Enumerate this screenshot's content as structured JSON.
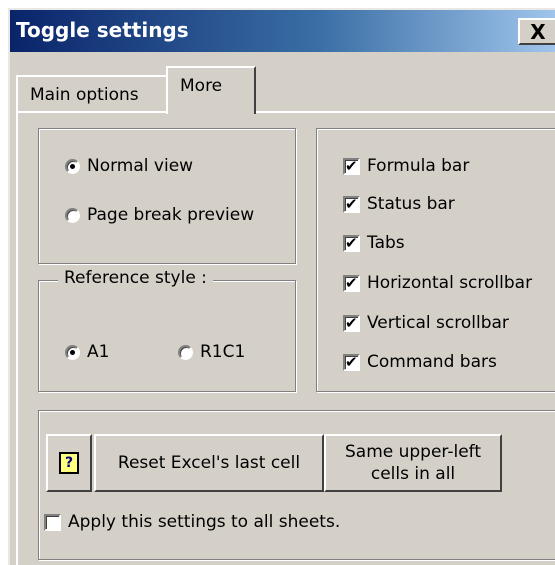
{
  "window": {
    "title": "Toggle settings",
    "close_glyph": "X"
  },
  "tabs": [
    {
      "label": "Main options",
      "selected": false
    },
    {
      "label": "More",
      "selected": true
    }
  ],
  "view_group": {
    "options": [
      {
        "label": "Normal view",
        "checked": true
      },
      {
        "label": "Page break preview",
        "checked": false
      }
    ]
  },
  "reference_group": {
    "legend": "Reference style :",
    "options": [
      {
        "label": "A1",
        "checked": true
      },
      {
        "label": "R1C1",
        "checked": false
      }
    ]
  },
  "display_group": {
    "items": [
      {
        "label": "Formula bar",
        "checked": true
      },
      {
        "label": "Status bar",
        "checked": true
      },
      {
        "label": "Tabs",
        "checked": true
      },
      {
        "label": "Horizontal scrollbar",
        "checked": true
      },
      {
        "label": "Vertical scrollbar",
        "checked": true
      },
      {
        "label": "Command bars",
        "checked": true
      }
    ]
  },
  "actions": {
    "help_icon": "help-icon",
    "help_glyph": "?",
    "reset_label": "Reset Excel's last cell",
    "same_cells_line1": "Same upper-left",
    "same_cells_line2": "cells in all",
    "apply_all_label": "Apply this settings to all sheets.",
    "apply_all_checked": false
  },
  "colors": {
    "face": "#d4d0c8",
    "title_start": "#0a246a",
    "title_end": "#a6caf0"
  }
}
